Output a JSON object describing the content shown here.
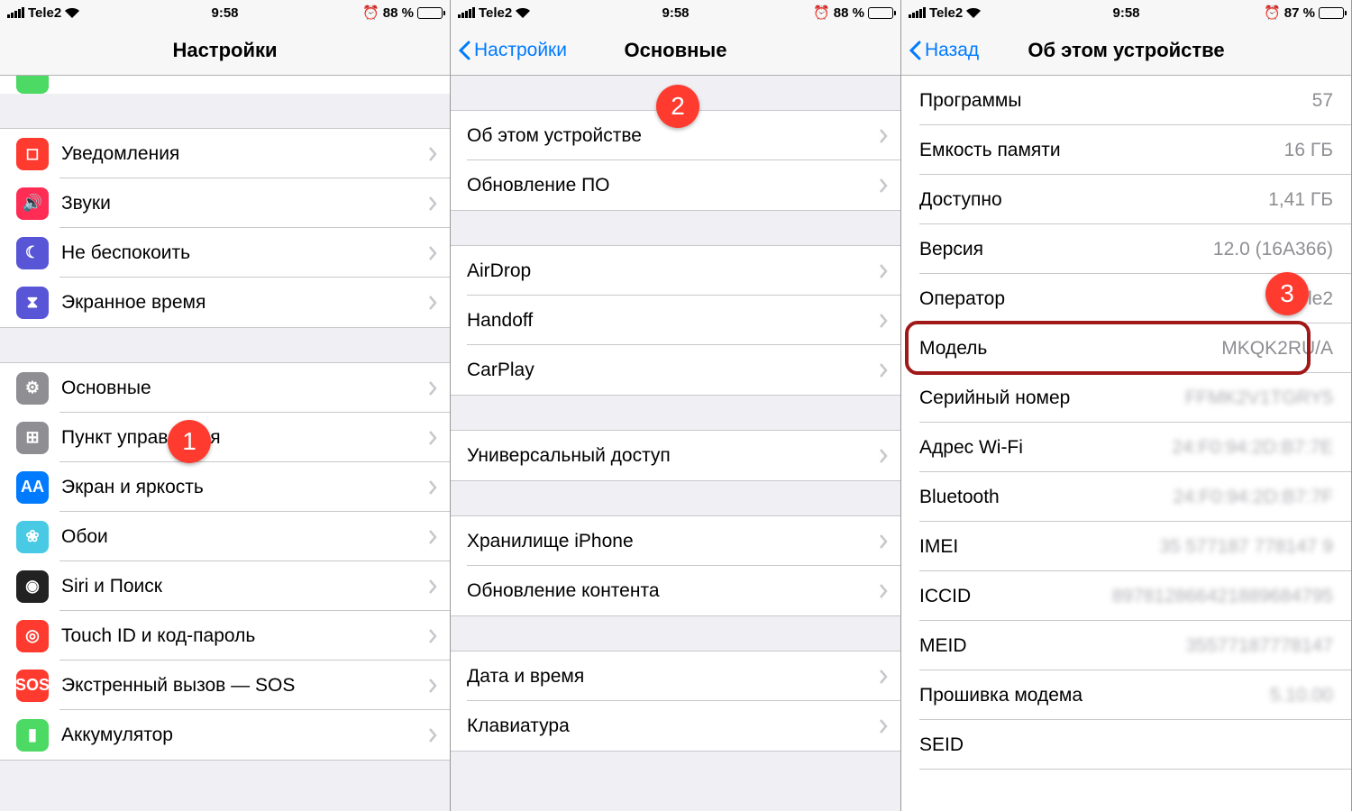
{
  "status": {
    "carrier": "Tele2",
    "time": "9:58",
    "battery1": "88 %",
    "battery2": "88 %",
    "battery3": "87 %"
  },
  "p1": {
    "title": "Настройки",
    "rows1": [
      {
        "label": "Уведомления",
        "icon": "#ff3b30",
        "sym": "◻"
      },
      {
        "label": "Звуки",
        "icon": "#ff2d55",
        "sym": "🔊"
      },
      {
        "label": "Не беспокоить",
        "icon": "#5856d6",
        "sym": "☾"
      },
      {
        "label": "Экранное время",
        "icon": "#5856d6",
        "sym": "⧗"
      }
    ],
    "rows2": [
      {
        "label": "Основные",
        "icon": "#8e8e93",
        "sym": "⚙"
      },
      {
        "label": "Пункт управления",
        "icon": "#8e8e93",
        "sym": "⊞"
      },
      {
        "label": "Экран и яркость",
        "icon": "#007aff",
        "sym": "AA"
      },
      {
        "label": "Обои",
        "icon": "#48cae4",
        "sym": "❀"
      },
      {
        "label": "Siri и Поиск",
        "icon": "#222",
        "sym": "◉"
      },
      {
        "label": "Touch ID и код-пароль",
        "icon": "#ff3b30",
        "sym": "◎"
      },
      {
        "label": "Экстренный вызов — SOS",
        "icon": "#ff3b30",
        "sym": "SOS"
      },
      {
        "label": "Аккумулятор",
        "icon": "#4cd964",
        "sym": "▮"
      }
    ]
  },
  "p2": {
    "back": "Настройки",
    "title": "Основные",
    "g1": [
      "Об этом устройстве",
      "Обновление ПО"
    ],
    "g2": [
      "AirDrop",
      "Handoff",
      "CarPlay"
    ],
    "g3": [
      "Универсальный доступ"
    ],
    "g4": [
      "Хранилище iPhone",
      "Обновление контента"
    ],
    "g5": [
      "Дата и время",
      "Клавиатура"
    ]
  },
  "p3": {
    "back": "Назад",
    "title": "Об этом устройстве",
    "rows": [
      {
        "l": "Программы",
        "v": "57"
      },
      {
        "l": "Емкость памяти",
        "v": "16 ГБ"
      },
      {
        "l": "Доступно",
        "v": "1,41 ГБ"
      },
      {
        "l": "Версия",
        "v": "12.0 (16A366)"
      },
      {
        "l": "Оператор",
        "v": "Tele2"
      },
      {
        "l": "Модель",
        "v": "MKQK2RU/A"
      },
      {
        "l": "Серийный номер",
        "v": "FFMK2V1TGRY5",
        "blur": true
      },
      {
        "l": "Адрес Wi-Fi",
        "v": "24:F0:94:2D:B7:7E",
        "blur": true
      },
      {
        "l": "Bluetooth",
        "v": "24:F0:94:2D:B7:7F",
        "blur": true
      },
      {
        "l": "IMEI",
        "v": "35 577187 778147 9",
        "blur": true
      },
      {
        "l": "ICCID",
        "v": "897812866421889684795",
        "blur": true
      },
      {
        "l": "MEID",
        "v": "35577187778147",
        "blur": true
      },
      {
        "l": "Прошивка модема",
        "v": "5.10.00",
        "blur": true
      },
      {
        "l": "SEID",
        "v": "",
        "blur": false
      }
    ]
  },
  "badges": {
    "b1": "1",
    "b2": "2",
    "b3": "3"
  }
}
